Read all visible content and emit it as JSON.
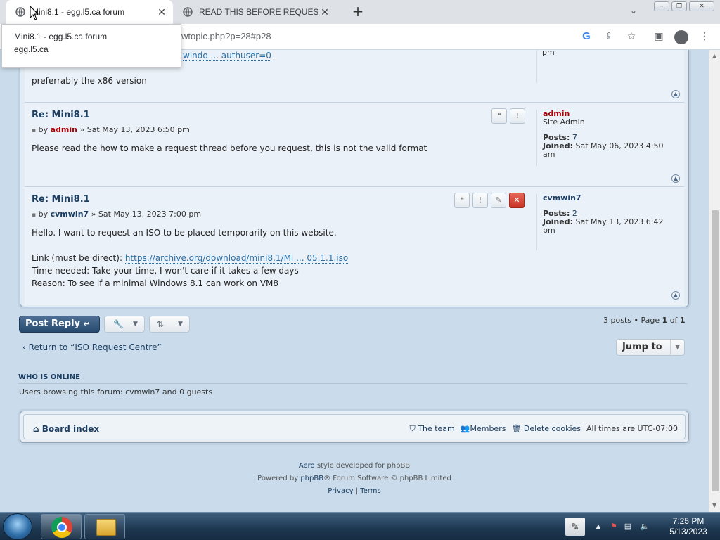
{
  "browser": {
    "tabs": [
      {
        "title": "Mini8.1 - egg.l5.ca forum",
        "active": true
      },
      {
        "title": "READ THIS BEFORE REQUESTING",
        "active": false
      }
    ],
    "url_visible": "wtopic.php?p=28#p28",
    "hover_card": {
      "title": "Mini8.1 - egg.l5.ca forum",
      "domain": "egg.l5.ca"
    }
  },
  "posts": [
    {
      "partial_link": "windo ... authuser=0",
      "partial_profile_tail": "pm",
      "body": "preferrably the x86 version"
    },
    {
      "title": "Re: Mini8.1",
      "by": "by",
      "author": "admin",
      "date": "» Sat May 13, 2023 6:50 pm",
      "body": "Please read the how to make a request thread before you request, this is not the valid format",
      "profile": {
        "name": "admin",
        "rank": "Site Admin",
        "posts_label": "Posts:",
        "posts": "7",
        "joined_label": "Joined:",
        "joined": "Sat May 06, 2023 4:50",
        "joined_tail": "am"
      }
    },
    {
      "title": "Re: Mini8.1",
      "by": "by",
      "author": "cvmwin7",
      "date": "» Sat May 13, 2023 7:00 pm",
      "line1": "Hello. I want to request an ISO to be placed temporarily on this website.",
      "link_label": "Link (must be direct):",
      "link": "https://archive.org/download/mini8.1/Mi ... 05.1.1.iso",
      "time_needed": "Time needed: Take your time, I won't care if it takes a few days",
      "reason": "Reason: To see if a minimal Windows 8.1 can work on VM8",
      "profile": {
        "name": "cvmwin7",
        "posts_label": "Posts:",
        "posts": "2",
        "joined_label": "Joined:",
        "joined": "Sat May 13, 2023 6:42",
        "joined_tail": "pm"
      }
    }
  ],
  "actions": {
    "post_reply": "Post Reply",
    "pagination_prefix": "3 posts • Page",
    "page": "1",
    "of": "of",
    "total_pages": "1",
    "return_link": "Return to “ISO Request Centre”",
    "jump_to": "Jump to"
  },
  "who_is_online": {
    "heading": "WHO IS ONLINE",
    "text": "Users browsing this forum: cvmwin7 and 0 guests"
  },
  "footer_nav": {
    "board_index": "Board index",
    "team": "The team",
    "members": "Members",
    "delete_cookies": "Delete cookies",
    "times": "All times are",
    "timezone": "UTC-07:00"
  },
  "credits": {
    "style_name": "Aero",
    "style_text": "style developed for phpBB",
    "powered_prefix": "Powered by",
    "phpbb": "phpBB",
    "powered_suffix": "® Forum Software © phpBB Limited",
    "privacy": "Privacy",
    "sep": "|",
    "terms": "Terms"
  },
  "taskbar": {
    "time": "7:25 PM",
    "date": "5/13/2023"
  }
}
